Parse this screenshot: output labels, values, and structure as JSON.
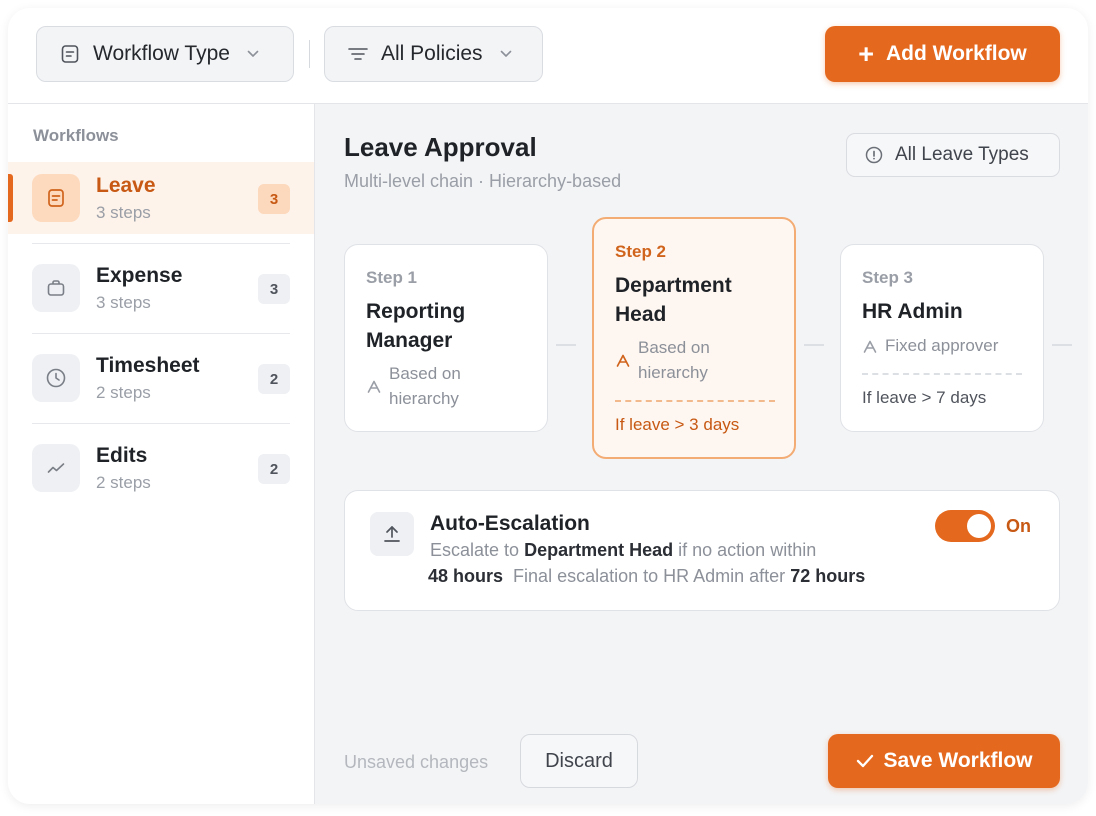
{
  "toolbar": {
    "workflow_type": {
      "label": "Workflow Type",
      "icon": "document-icon"
    },
    "policies": {
      "label": "All Policies",
      "icon": "filter-lines-icon"
    },
    "add_button": "Add Workflow"
  },
  "sidebar": {
    "title": "Workflows",
    "items": [
      {
        "name": "Leave",
        "steps": "3 steps",
        "count": "3",
        "icon": "document-icon",
        "active": true
      },
      {
        "name": "Expense",
        "steps": "3 steps",
        "count": "3",
        "icon": "briefcase-icon",
        "active": false
      },
      {
        "name": "Timesheet",
        "steps": "2 steps",
        "count": "2",
        "icon": "clock-icon",
        "active": false
      },
      {
        "name": "Edits",
        "steps": "2 steps",
        "count": "2",
        "icon": "trend-icon",
        "active": false
      }
    ]
  },
  "main": {
    "title": "Leave Approval",
    "subtitle": "Multi-level chain · Hierarchy-based",
    "filter_button": "All Leave Types",
    "steps": [
      {
        "label": "Step 1",
        "title_line1": "Reporting",
        "title_line2": "Manager",
        "desc_line1": "Based on",
        "desc_line2": "hierarchy",
        "condition": ""
      },
      {
        "label": "Step 2",
        "title_line1": "Department",
        "title_line2": "Head",
        "desc_line1": "Based on",
        "desc_line2": "hierarchy",
        "condition": "If leave > 3 days"
      },
      {
        "label": "Step 3",
        "title_line1": "HR Admin",
        "title_line2": "",
        "desc_line1": "Fixed approver",
        "desc_line2": "",
        "condition": "If leave > 7 days"
      }
    ],
    "escalation": {
      "title": "Auto-Escalation",
      "line1_prefix": "Escalate to",
      "line1_target": "Department Head",
      "line1_suffix": "if no action within",
      "first_wait": "48 hours",
      "line2_text": "Final escalation to HR Admin after",
      "final_wait": "72 hours",
      "toggle_state": "On",
      "enabled": true
    },
    "footer": {
      "status": "Unsaved changes",
      "discard": "Discard",
      "save": "Save Workflow"
    }
  },
  "colors": {
    "accent": "#e4691f",
    "accent_text": "#c75914",
    "active_bg": "#fef3ea",
    "main_bg": "#f3f4f6"
  }
}
